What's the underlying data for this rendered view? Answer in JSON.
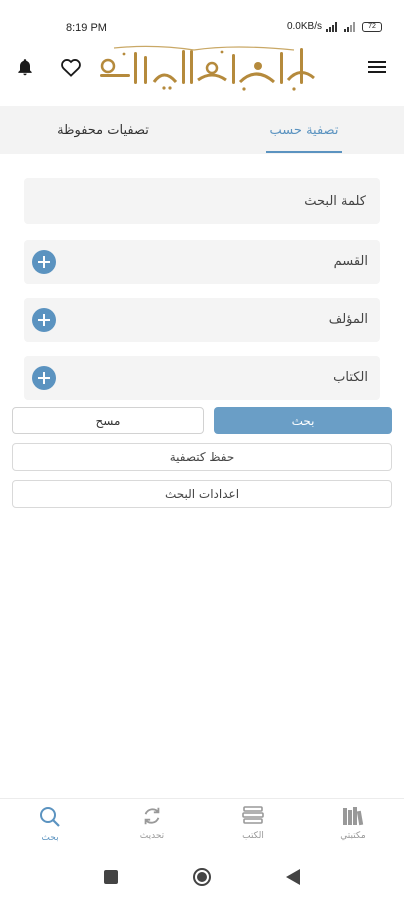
{
  "status_bar": {
    "time": "8:19 PM",
    "net_speed": "0.0KB/s",
    "battery": "72"
  },
  "header": {
    "logo_text": "الموسوعة الإباضية",
    "icons": [
      "bell-icon",
      "heart-icon",
      "menu-icon"
    ]
  },
  "tabs": {
    "filter_by": "تصفية حسب",
    "saved_filters": "تصفيات محفوظة",
    "active": "filter_by"
  },
  "form": {
    "keyword_placeholder": "كلمة البحث",
    "section_label": "القسم",
    "author_label": "المؤلف",
    "book_label": "الكتاب"
  },
  "buttons": {
    "search": "بحث",
    "clear": "مسح",
    "save_filter": "حفظ كتصفية",
    "search_settings": "اعدادات البحث"
  },
  "bottom_nav": {
    "search": "بحث",
    "update": "تحديث",
    "books": "الكتب",
    "library": "مكتبتي",
    "active": "search"
  },
  "colors": {
    "accent": "#5b93c0",
    "field_bg": "#f4f4f4",
    "tab_bg": "#f3f3f3",
    "logo_gold": "#b58a3c"
  }
}
